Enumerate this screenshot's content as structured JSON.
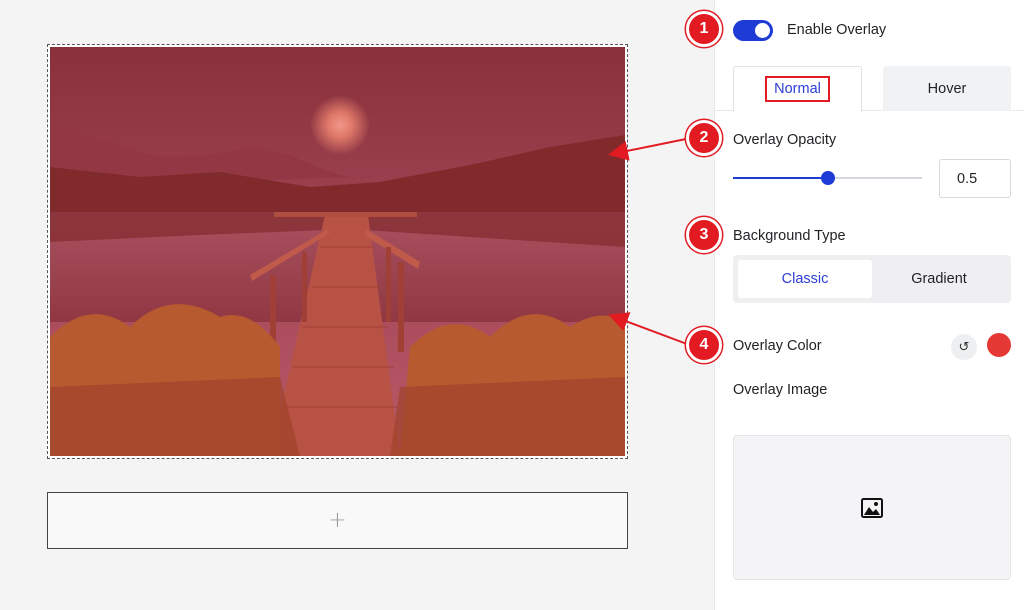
{
  "canvas": {
    "image_alt": "Lake with wooden pier at dusk",
    "add_section_symbol": "+"
  },
  "panel": {
    "enable_overlay_label": "Enable Overlay",
    "enable_overlay_on": true,
    "tabs": [
      {
        "label": "Normal",
        "active": true
      },
      {
        "label": "Hover",
        "active": false
      }
    ],
    "overlay_opacity_label": "Overlay Opacity",
    "overlay_opacity_value": "0.5",
    "background_type_label": "Background Type",
    "background_type_options": [
      {
        "label": "Classic",
        "active": true
      },
      {
        "label": "Gradient",
        "active": false
      }
    ],
    "overlay_color_label": "Overlay Color",
    "overlay_color": "#e53935",
    "reset_icon": "reset-icon",
    "overlay_image_label": "Overlay Image",
    "media_icon": "image-icon"
  },
  "annotations": [
    "1",
    "2",
    "3",
    "4"
  ],
  "colors": {
    "accent": "#1f3bd6",
    "marker": "#e21b23",
    "overlay": "#e53935"
  }
}
